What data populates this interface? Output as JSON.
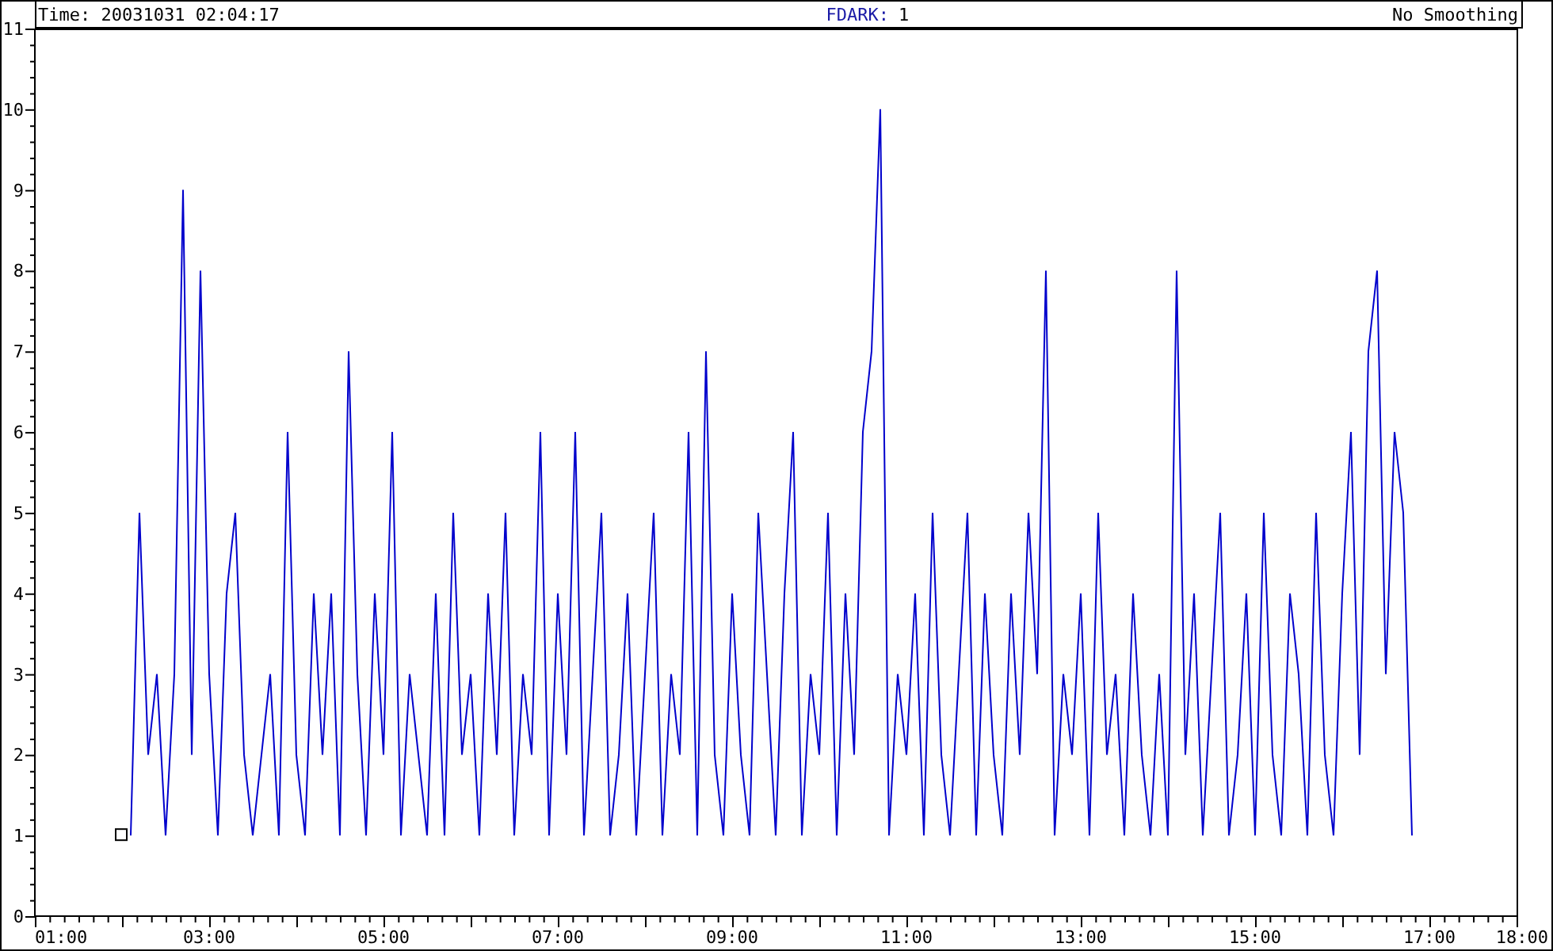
{
  "header": {
    "time": "Time: 20031031 02:04:17",
    "channel_label": "FDARK:",
    "channel_value": "1",
    "smoothing": "No Smoothing"
  },
  "chart_data": {
    "type": "line",
    "xlim": [
      1,
      18
    ],
    "ylim": [
      0,
      11
    ],
    "yticks": [
      0,
      1,
      2,
      3,
      4,
      5,
      6,
      7,
      8,
      9,
      10,
      11
    ],
    "xticks": [
      {
        "value": 1,
        "label": "01:00"
      },
      {
        "value": 3,
        "label": "03:00"
      },
      {
        "value": 5,
        "label": "05:00"
      },
      {
        "value": 7,
        "label": "07:00"
      },
      {
        "value": 9,
        "label": "09:00"
      },
      {
        "value": 11,
        "label": "11:00"
      },
      {
        "value": 13,
        "label": "13:00"
      },
      {
        "value": 15,
        "label": "15:00"
      },
      {
        "value": 17,
        "label": "17:00"
      },
      {
        "value": 18,
        "label": "18:00"
      }
    ],
    "x": [
      2.1,
      2.2,
      2.3,
      2.4,
      2.5,
      2.6,
      2.7,
      2.8,
      2.9,
      3.0,
      3.1,
      3.2,
      3.3,
      3.4,
      3.5,
      3.6,
      3.7,
      3.8,
      3.9,
      4.0,
      4.1,
      4.2,
      4.3,
      4.4,
      4.5,
      4.6,
      4.7,
      4.8,
      4.9,
      5.0,
      5.1,
      5.2,
      5.3,
      5.4,
      5.5,
      5.6,
      5.7,
      5.8,
      5.9,
      6.0,
      6.1,
      6.2,
      6.3,
      6.4,
      6.5,
      6.6,
      6.7,
      6.8,
      6.9,
      7.0,
      7.1,
      7.2,
      7.3,
      7.4,
      7.5,
      7.6,
      7.7,
      7.8,
      7.9,
      8.0,
      8.1,
      8.2,
      8.3,
      8.4,
      8.5,
      8.6,
      8.7,
      8.8,
      8.9,
      9.0,
      9.1,
      9.2,
      9.3,
      9.4,
      9.5,
      9.6,
      9.7,
      9.8,
      9.9,
      10.0,
      10.1,
      10.2,
      10.3,
      10.4,
      10.5,
      10.6,
      10.7,
      10.8,
      10.9,
      11.0,
      11.1,
      11.2,
      11.3,
      11.4,
      11.5,
      11.6,
      11.7,
      11.8,
      11.9,
      12.0,
      12.1,
      12.2,
      12.3,
      12.4,
      12.5,
      12.6,
      12.7,
      12.8,
      12.9,
      13.0,
      13.1,
      13.2,
      13.3,
      13.4,
      13.5,
      13.6,
      13.7,
      13.8,
      13.9,
      14.0,
      14.1,
      14.2,
      14.3,
      14.4,
      14.5,
      14.6,
      14.7,
      14.8,
      14.9,
      15.0,
      15.1,
      15.2,
      15.3,
      15.4,
      15.5,
      15.6,
      15.7,
      15.8,
      15.9,
      16.0,
      16.1,
      16.2,
      16.3,
      16.4,
      16.5,
      16.6,
      16.7,
      16.8
    ],
    "series": [
      {
        "color": "#0000cc",
        "values": [
          1,
          5,
          2,
          3,
          1,
          3,
          9,
          2,
          8,
          3,
          1,
          4,
          5,
          2,
          1,
          2,
          3,
          1,
          6,
          2,
          1,
          4,
          2,
          4,
          1,
          7,
          3,
          1,
          4,
          2,
          6,
          1,
          3,
          2,
          1,
          4,
          1,
          5,
          2,
          3,
          1,
          4,
          2,
          5,
          1,
          3,
          2,
          6,
          1,
          4,
          2,
          6,
          1,
          3,
          5,
          1,
          2,
          4,
          1,
          3,
          5,
          1,
          3,
          2,
          6,
          1,
          7,
          2,
          1,
          4,
          2,
          1,
          5,
          3,
          1,
          4,
          6,
          1,
          3,
          2,
          5,
          1,
          4,
          2,
          6,
          7,
          10,
          1,
          3,
          2,
          4,
          1,
          5,
          2,
          1,
          3,
          5,
          1,
          4,
          2,
          1,
          4,
          2,
          5,
          3,
          8,
          1,
          3,
          2,
          4,
          1,
          5,
          2,
          3,
          1,
          4,
          2,
          1,
          3,
          1,
          8,
          2,
          4,
          1,
          3,
          5,
          1,
          2,
          4,
          1,
          5,
          2,
          1,
          4,
          3,
          1,
          5,
          2,
          1,
          4,
          6,
          2,
          7,
          8,
          3,
          6,
          5,
          1
        ]
      }
    ]
  }
}
